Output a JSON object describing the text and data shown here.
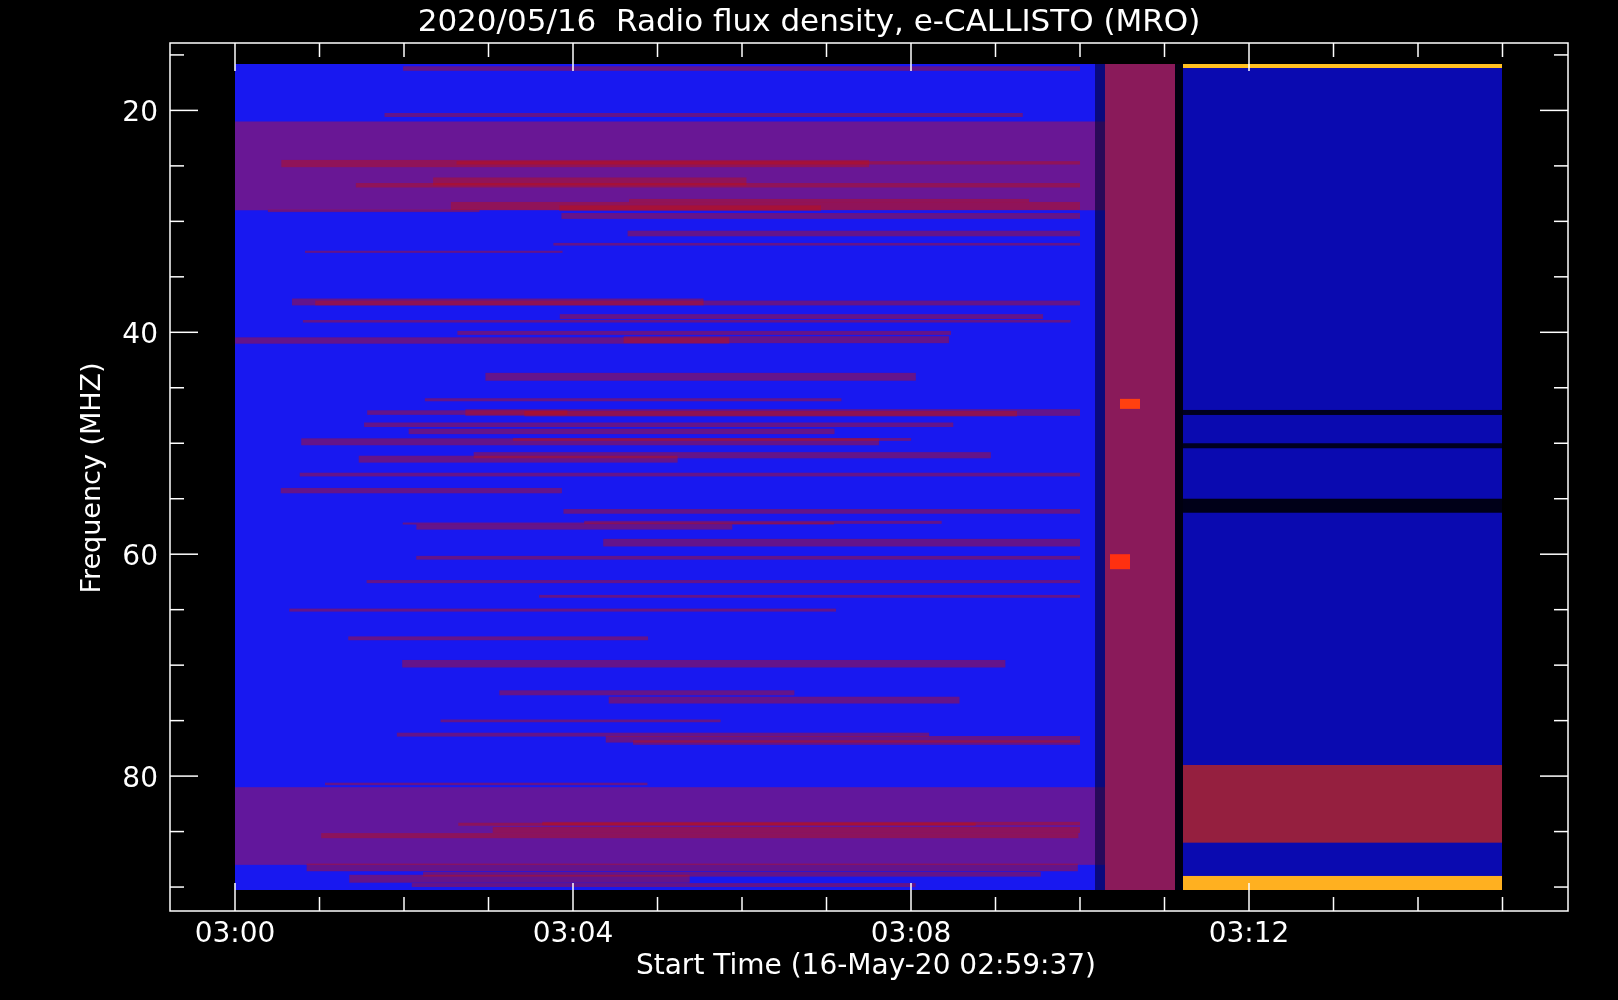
{
  "title": "2020/05/16  Radio flux density, e-CALLISTO (MRO)",
  "y_axis": {
    "label": "Frequency (MHZ)",
    "ticks": [
      "20",
      "40",
      "60",
      "80"
    ]
  },
  "x_axis": {
    "label": "Start Time (16-May-20 02:59:37)",
    "ticks": [
      "03:00",
      "03:04",
      "03:08",
      "03:12"
    ]
  }
}
